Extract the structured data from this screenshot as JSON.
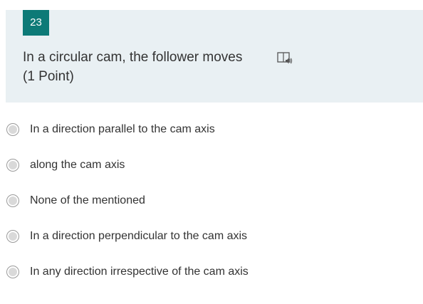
{
  "question": {
    "number": "23",
    "text": "In a circular cam, the follower moves",
    "points": "(1 Point)",
    "reader_icon": "immersive-reader-icon"
  },
  "options": [
    {
      "label": "In a direction parallel to the cam axis"
    },
    {
      "label": "along the cam axis"
    },
    {
      "label": "None of the mentioned"
    },
    {
      "label": "In a direction perpendicular to the cam axis"
    },
    {
      "label": "In any direction irrespective of the cam axis"
    }
  ],
  "colors": {
    "accent": "#0d7a77",
    "card_background": "#e9f0f3",
    "text": "#333333"
  }
}
